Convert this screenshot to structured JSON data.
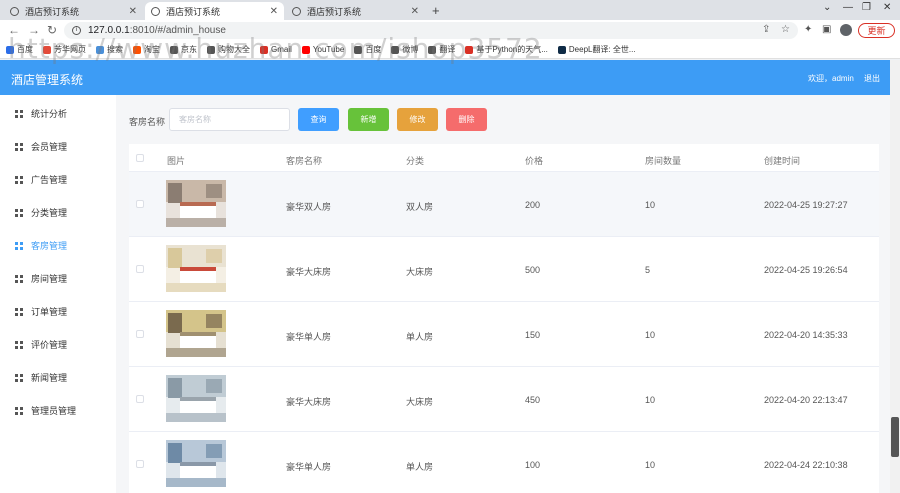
{
  "browser": {
    "tabs": [
      {
        "title": "酒店预订系统"
      },
      {
        "title": "酒店预订系统"
      },
      {
        "title": "酒店预订系统"
      }
    ],
    "url_host": "127.0.0.1",
    "url_rest": ":8010/#/admin_house",
    "update_label": "更新",
    "bookmarks": [
      {
        "label": "百度",
        "color": "#2b6de8"
      },
      {
        "label": "芳华网页",
        "color": "#e34b3a"
      },
      {
        "label": "搜索",
        "color": "#4a90d9"
      },
      {
        "label": "淘宝",
        "color": "#ff5000"
      },
      {
        "label": "京东",
        "color": "#555555"
      },
      {
        "label": "购物大全",
        "color": "#555555"
      },
      {
        "label": "Gmail",
        "color": "#d93025"
      },
      {
        "label": "YouTube",
        "color": "#ff0000"
      },
      {
        "label": "百度",
        "color": "#555555"
      },
      {
        "label": "微博",
        "color": "#555555"
      },
      {
        "label": "翻译",
        "color": "#555555"
      },
      {
        "label": "基于Python的天气...",
        "color": "#d93025"
      },
      {
        "label": "DeepL翻译: 全世...",
        "color": "#0f2b46"
      }
    ],
    "watermark": "https://www.huzhan.com/ishop3572"
  },
  "app": {
    "title": "酒店管理系统",
    "welcome": "欢迎，admin",
    "logout": "退出",
    "accent": "#3d9cf5"
  },
  "sidebar": {
    "items": [
      {
        "label": "统计分析"
      },
      {
        "label": "会员管理"
      },
      {
        "label": "广告管理"
      },
      {
        "label": "分类管理"
      },
      {
        "label": "客房管理",
        "active": true
      },
      {
        "label": "房间管理"
      },
      {
        "label": "订单管理"
      },
      {
        "label": "评价管理"
      },
      {
        "label": "新闻管理"
      },
      {
        "label": "管理员管理"
      }
    ]
  },
  "search": {
    "label": "客房名称",
    "placeholder": "客房名称",
    "value": ""
  },
  "buttons": {
    "query": "查询",
    "add": "新增",
    "edit": "修改",
    "delete": "删除"
  },
  "table": {
    "headers": {
      "image": "图片",
      "name": "客房名称",
      "category": "分类",
      "price": "价格",
      "count": "房间数量",
      "created": "创建时间"
    },
    "rows": [
      {
        "name": "豪华双人房",
        "category": "双人房",
        "price": "200",
        "count": "10",
        "created": "2022-04-25 19:27:27"
      },
      {
        "name": "豪华大床房",
        "category": "大床房",
        "price": "500",
        "count": "5",
        "created": "2022-04-25 19:26:54"
      },
      {
        "name": "豪华单人房",
        "category": "单人房",
        "price": "150",
        "count": "10",
        "created": "2022-04-20 14:35:33"
      },
      {
        "name": "豪华大床房",
        "category": "大床房",
        "price": "450",
        "count": "10",
        "created": "2022-04-20 22:13:47"
      },
      {
        "name": "豪华单人房",
        "category": "单人房",
        "price": "100",
        "count": "10",
        "created": "2022-04-24 22:10:38"
      }
    ]
  }
}
